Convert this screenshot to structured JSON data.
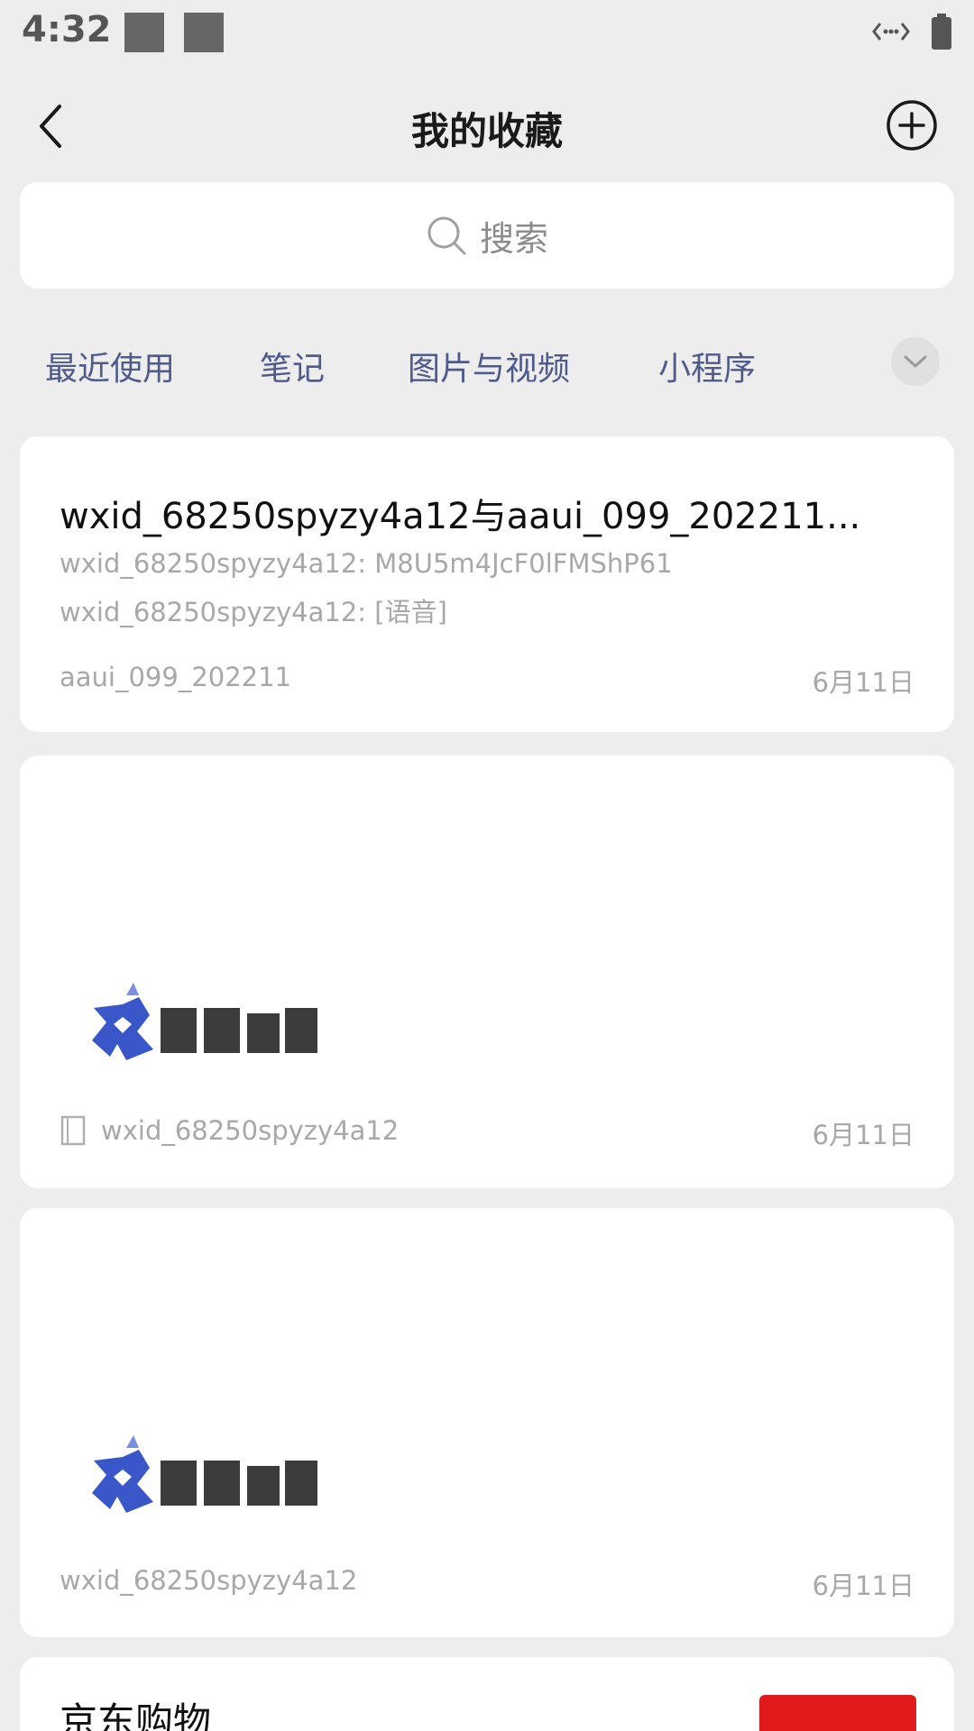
{
  "status_bar": {
    "time": "4:32"
  },
  "header": {
    "title": "我的收藏"
  },
  "search": {
    "placeholder": "搜索"
  },
  "categories": [
    "最近使用",
    "笔记",
    "图片与视频",
    "小程序"
  ],
  "items": [
    {
      "title": "wxid_68250spyzy4a12与aaui_099_202211...",
      "lines": [
        "wxid_68250spyzy4a12: M8U5m4JcF0lFMShP61",
        "wxid_68250spyzy4a12: [语音]"
      ],
      "source": "aaui_099_202211",
      "date": "6月11日"
    },
    {
      "source": "wxid_68250spyzy4a12",
      "date": "6月11日",
      "icon": "note-icon"
    },
    {
      "source": "wxid_68250spyzy4a12",
      "date": "6月11日"
    },
    {
      "title": "京东购物"
    }
  ],
  "colors": {
    "background": "#ededed",
    "category_text": "#4f5b8b",
    "logo_blue": "#3a57c9"
  }
}
